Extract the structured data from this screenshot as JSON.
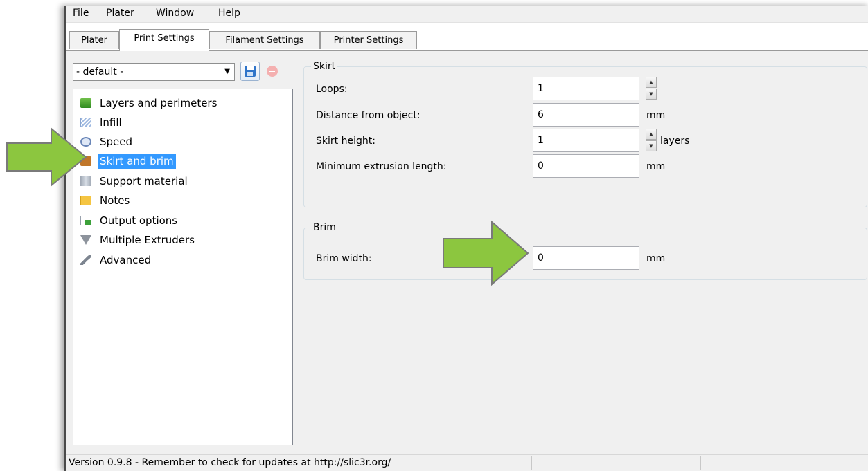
{
  "menu": [
    "File",
    "Plater",
    "Window",
    "Help"
  ],
  "tabs": [
    "Plater",
    "Print Settings",
    "Filament Settings",
    "Printer Settings"
  ],
  "active_tab": "Print Settings",
  "preset": {
    "selected": "- default -"
  },
  "tree": [
    {
      "label": "Layers and perimeters",
      "icon": "layers-icon"
    },
    {
      "label": "Infill",
      "icon": "infill-icon"
    },
    {
      "label": "Speed",
      "icon": "speed-icon"
    },
    {
      "label": "Skirt and brim",
      "icon": "skirt-brim-icon",
      "selected": true
    },
    {
      "label": "Support material",
      "icon": "support-icon"
    },
    {
      "label": "Notes",
      "icon": "notes-icon"
    },
    {
      "label": "Output options",
      "icon": "output-icon"
    },
    {
      "label": "Multiple Extruders",
      "icon": "funnel-icon"
    },
    {
      "label": "Advanced",
      "icon": "wrench-icon"
    }
  ],
  "skirt": {
    "title": "Skirt",
    "loops_label": "Loops:",
    "loops_value": "1",
    "distance_label": "Distance from object:",
    "distance_value": "6",
    "distance_unit": "mm",
    "height_label": "Skirt height:",
    "height_value": "1",
    "height_unit": "layers",
    "minext_label": "Minimum extrusion length:",
    "minext_value": "0",
    "minext_unit": "mm"
  },
  "brim": {
    "title": "Brim",
    "width_label": "Brim width:",
    "width_value": "0",
    "width_unit": "mm"
  },
  "status": "Version 0.9.8 - Remember to check for updates at http://slic3r.org/",
  "colors": {
    "selection": "#3399ff",
    "annotation_arrow": "#8cc63f"
  }
}
